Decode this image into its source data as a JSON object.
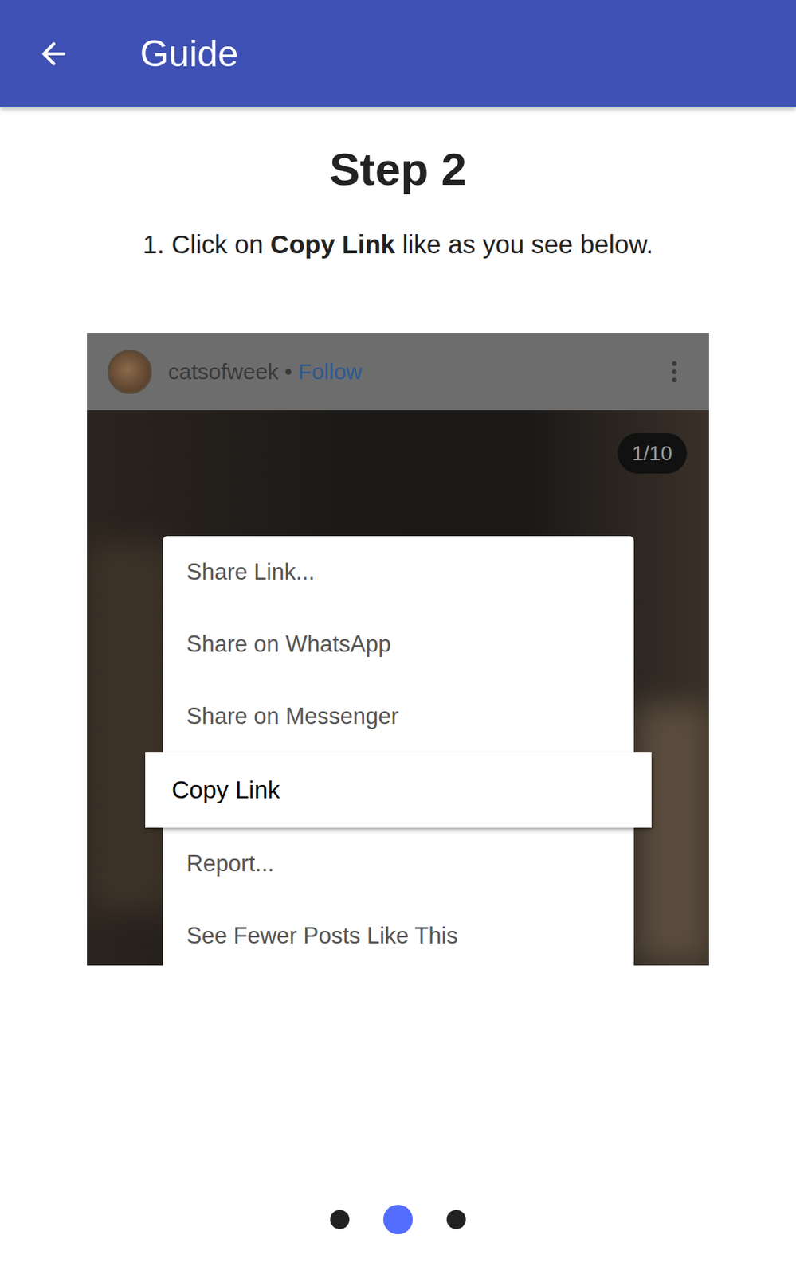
{
  "app_bar": {
    "title": "Guide"
  },
  "step": {
    "title": "Step 2",
    "instruction": {
      "before": "1. Click on ",
      "bold": "Copy Link",
      "after": " like as you see below."
    }
  },
  "example": {
    "username": "catsofweek",
    "separator": "•",
    "follow": "Follow",
    "counter": "1/10",
    "menu": [
      {
        "label": "Share Link...",
        "selected": false
      },
      {
        "label": "Share on WhatsApp",
        "selected": false
      },
      {
        "label": "Share on Messenger",
        "selected": false
      },
      {
        "label": "Copy Link",
        "selected": true
      },
      {
        "label": "Report...",
        "selected": false
      },
      {
        "label": "See Fewer Posts Like This",
        "selected": false
      }
    ]
  },
  "pager": [
    {
      "selected": false
    },
    {
      "selected": true
    },
    {
      "selected": false
    }
  ]
}
